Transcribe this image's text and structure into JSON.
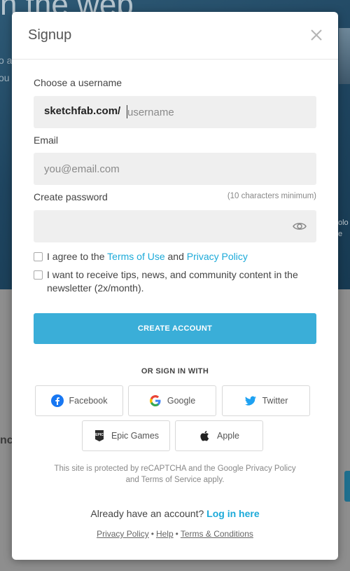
{
  "background": {
    "hero_text": "n the web",
    "hero_sub_1": "o a",
    "hero_sub_2": "ou",
    "lower_text": "nc",
    "right_small_1": "olo",
    "right_small_2": "e"
  },
  "modal": {
    "title": "Signup",
    "close_icon": "close-icon"
  },
  "form": {
    "username_label": "Choose a username",
    "username_prefix": "sketchfab.com/",
    "username_placeholder": "username",
    "username_value": "",
    "email_label": "Email",
    "email_placeholder": "you@email.com",
    "email_value": "",
    "password_label": "Create password",
    "password_hint": "(10 characters minimum)",
    "password_value": "",
    "password_toggle_icon": "eye-icon"
  },
  "checks": {
    "terms_prefix": "I agree to the",
    "terms_link": "Terms of Use",
    "terms_and": "and",
    "privacy_link": "Privacy Policy",
    "terms_checked": false,
    "newsletter_text": "I want to receive tips, news, and community content in the newsletter (2x/month).",
    "newsletter_checked": false
  },
  "create_button": "CREATE ACCOUNT",
  "or_sign_in": "OR SIGN IN WITH",
  "social": {
    "facebook": "Facebook",
    "google": "Google",
    "twitter": "Twitter",
    "epic": "Epic Games",
    "apple": "Apple"
  },
  "colors": {
    "accent": "#3aaed8",
    "link": "#1caad9",
    "facebook": "#1877f2",
    "twitter": "#1da1f2"
  },
  "recaptcha": {
    "line1": "This site is protected by reCAPTCHA and the Google Privacy Policy",
    "line2": "and Terms of Service apply."
  },
  "login": {
    "prompt": "Already have an account?",
    "link": "Log in here"
  },
  "footer": {
    "privacy": "Privacy Policy",
    "help": "Help",
    "terms": "Terms & Conditions",
    "separator": "•"
  }
}
